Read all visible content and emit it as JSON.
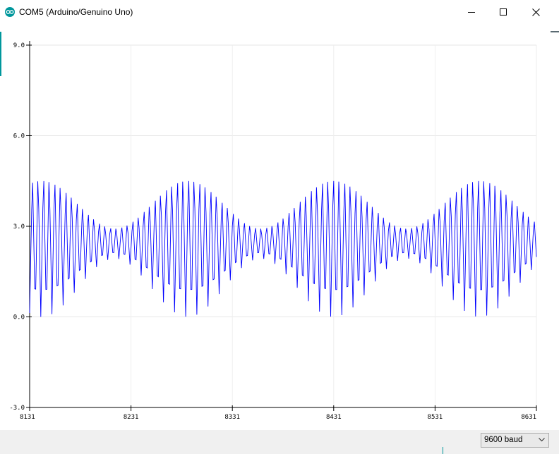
{
  "window": {
    "title": "COM5 (Arduino/Genuino Uno)",
    "icon": "arduino-logo-icon",
    "controls": [
      "minimize-icon",
      "maximize-icon",
      "close-icon"
    ]
  },
  "chart_data": {
    "type": "line",
    "title": "",
    "xlabel": "",
    "ylabel": "",
    "xlim": [
      8131,
      8631
    ],
    "ylim": [
      -3.0,
      9.0
    ],
    "xticks": [
      "8131",
      "8231",
      "8331",
      "8431",
      "8531",
      "8631"
    ],
    "yticks": [
      "9.0",
      "6.0",
      "3.0",
      "0.0",
      "-3.0"
    ],
    "grid": true,
    "legend": "none",
    "series": [
      {
        "color": "#0000ff",
        "description_values": {
          "carrier_period_samples": 5.5,
          "beat_period_samples": 144,
          "min": 0.0,
          "max": 4.95
        }
      }
    ]
  },
  "footer": {
    "baud_rate": "9600 baud"
  },
  "colors": {
    "accent": "#00979c",
    "plot_line": "#0000ff",
    "grid": "#e6e6e6",
    "footer_bg": "#f0f0f0"
  }
}
